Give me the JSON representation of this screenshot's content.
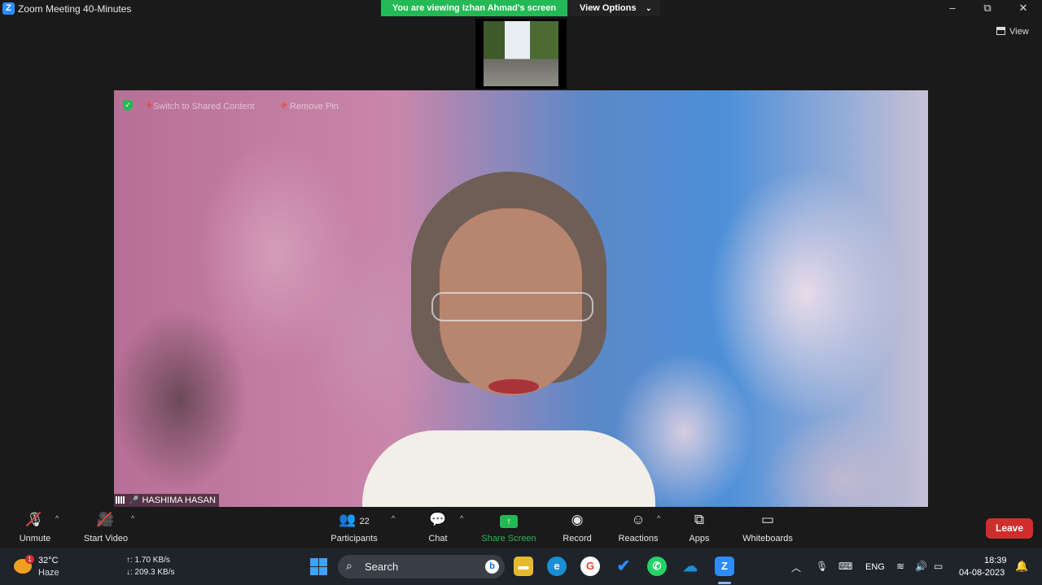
{
  "window": {
    "title": "Zoom Meeting 40-Minutes",
    "app_logo": "Z",
    "minimize": "–",
    "restore": "⧉",
    "close": "✕"
  },
  "share_banner": {
    "viewing_text": "You are viewing Izhan Ahmad's screen",
    "view_options_label": "View Options",
    "view_options_caret": "⌄"
  },
  "view_button": {
    "label": "View"
  },
  "pinned_toolbar": {
    "switch_label": "Switch to Shared Content",
    "remove_pin_label": "Remove Pin"
  },
  "participant": {
    "name": "HASHIMA HASAN"
  },
  "controls": {
    "unmute": "Unmute",
    "start_video": "Start Video",
    "participants": "Participants",
    "participants_count": "22",
    "chat": "Chat",
    "share_screen": "Share Screen",
    "record": "Record",
    "reactions": "Reactions",
    "apps": "Apps",
    "whiteboards": "Whiteboards",
    "leave": "Leave",
    "share_color": "#23b954",
    "leave_color": "#d22d2d"
  },
  "taskbar": {
    "weather_badge": "1",
    "temperature": "32°C",
    "weather": "Haze",
    "net_up": "↑: 1.70 KB/s",
    "net_down": "↓: 209.3 KB/s",
    "search_label": "Search",
    "bing_label": "b",
    "zoom_label": "Z",
    "language": "ENG",
    "time": "18:39",
    "date": "04-08-2023"
  }
}
